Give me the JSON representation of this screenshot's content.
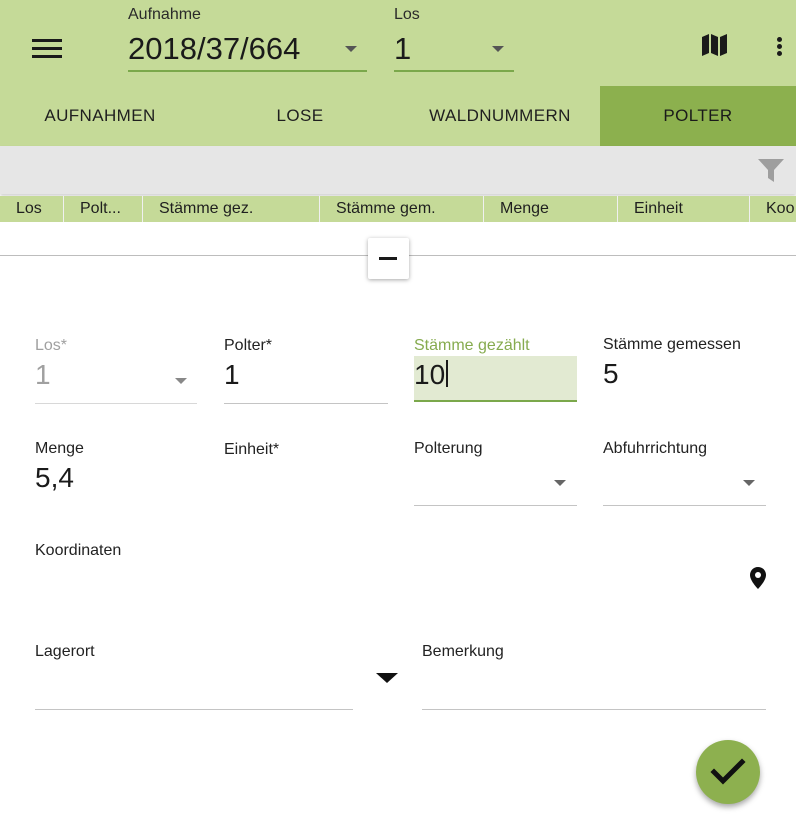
{
  "header": {
    "aufnahme": {
      "label": "Aufnahme",
      "value": "2018/37/664"
    },
    "los": {
      "label": "Los",
      "value": "1"
    },
    "icons": [
      "menu-icon",
      "map-icon",
      "more-vert-icon"
    ]
  },
  "tabs": [
    {
      "label": "AUFNAHMEN",
      "active": false
    },
    {
      "label": "LOSE",
      "active": false
    },
    {
      "label": "WALDNUMMERN",
      "active": false
    },
    {
      "label": "POLTER",
      "active": true
    }
  ],
  "filter": {
    "icon": "filter-icon"
  },
  "table": {
    "columns": [
      "Los",
      "Polt...",
      "Stämme gez.",
      "Stämme gem.",
      "Menge",
      "Einheit",
      "Koo"
    ]
  },
  "form": {
    "los": {
      "label": "Los*",
      "value": "1",
      "disabled": true
    },
    "polter": {
      "label": "Polter*",
      "value": "1"
    },
    "staemme_gezaehlt": {
      "label": "Stämme gezählt",
      "value": "10",
      "focused": true
    },
    "staemme_gemessen": {
      "label": "Stämme gemessen",
      "value": "5"
    },
    "menge": {
      "label": "Menge",
      "value": "5,4"
    },
    "einheit": {
      "label": "Einheit*",
      "value": ""
    },
    "polterung": {
      "label": "Polterung",
      "value": ""
    },
    "abfuhrrichtung": {
      "label": "Abfuhrrichtung",
      "value": ""
    },
    "koordinaten": {
      "label": "Koordinaten",
      "value": ""
    },
    "lagerort": {
      "label": "Lagerort",
      "value": ""
    },
    "bemerkung": {
      "label": "Bemerkung",
      "value": ""
    }
  },
  "colors": {
    "appbar": "#c5da98",
    "active_tab": "#8cb04e",
    "accent": "#7ba84b",
    "fab": "#8db04f"
  }
}
